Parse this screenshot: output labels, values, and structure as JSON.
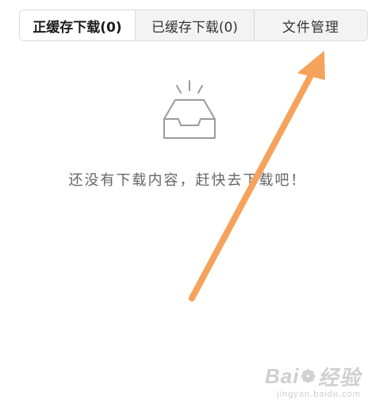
{
  "tabs": [
    {
      "label": "正缓存下载(0)",
      "active": true
    },
    {
      "label": "已缓存下载(0)",
      "active": false
    },
    {
      "label": "文件管理",
      "active": false
    }
  ],
  "empty_state": {
    "icon": "empty-tray-icon",
    "message": "还没有下载内容，赶快去下载吧！"
  },
  "annotation": {
    "icon": "annotation-arrow-icon",
    "color": "#f5a35c"
  },
  "watermark": {
    "brand_prefix": "Bai",
    "brand_suffix": "经验",
    "sub": "jingyan.baidu.com"
  }
}
